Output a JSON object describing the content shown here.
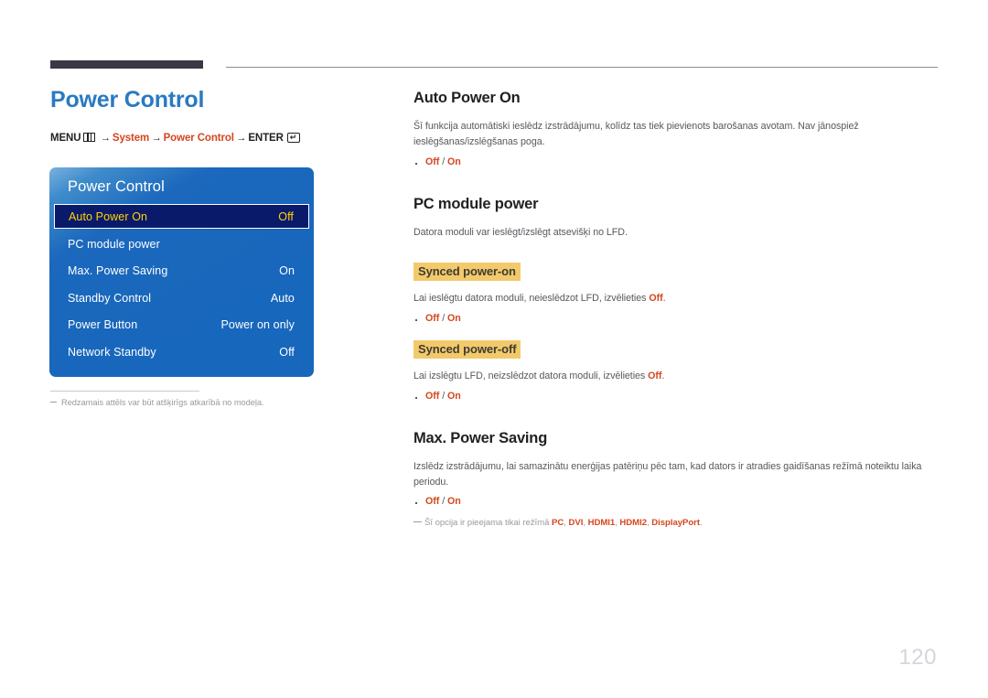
{
  "page": {
    "number": "120"
  },
  "left": {
    "title": "Power Control",
    "breadcrumb": {
      "menu_label": "MENU",
      "menu_icon": "menu-grid-icon",
      "arrow": "→",
      "step1": "System",
      "step2": "Power Control",
      "enter_label": "ENTER",
      "enter_icon": "enter-return-icon"
    },
    "osd": {
      "title": "Power Control",
      "rows": [
        {
          "label": "Auto Power On",
          "value": "Off",
          "selected": true
        },
        {
          "label": "PC module power",
          "value": "",
          "selected": false
        },
        {
          "label": "Max. Power Saving",
          "value": "On",
          "selected": false
        },
        {
          "label": "Standby Control",
          "value": "Auto",
          "selected": false
        },
        {
          "label": "Power Button",
          "value": "Power on only",
          "selected": false
        },
        {
          "label": "Network Standby",
          "value": "Off",
          "selected": false
        }
      ]
    },
    "note": "Redzamais attēls var būt atšķirīgs atkarībā no modeļa."
  },
  "right": {
    "sections": [
      {
        "heading": "Auto Power On",
        "paragraph": "Šī funkcija automātiski ieslēdz izstrādājumu, kolīdz tas tiek pievienots barošanas avotam. Nav jānospiež ieslēgšanas/izslēgšanas poga.",
        "bullet_off": "Off",
        "bullet_sep": " / ",
        "bullet_on": "On"
      },
      {
        "heading": "PC module power",
        "paragraph": "Datora moduli var ieslēgt/izslēgt atsevišķi no LFD.",
        "sub1": {
          "heading": "Synced power-on",
          "text_before": "Lai ieslēgtu datora moduli, neieslēdzot LFD, izvēlieties ",
          "text_accent": "Off",
          "text_after": ".",
          "bullet_off": "Off",
          "bullet_sep": " / ",
          "bullet_on": "On"
        },
        "sub2": {
          "heading": "Synced power-off",
          "text_before": "Lai izslēgtu LFD, neizslēdzot datora moduli, izvēlieties ",
          "text_accent": "Off",
          "text_after": ".",
          "bullet_off": "Off",
          "bullet_sep": " / ",
          "bullet_on": "On"
        }
      },
      {
        "heading": "Max. Power Saving",
        "paragraph": "Izslēdz izstrādājumu, lai samazinātu enerģijas patēriņu pēc tam, kad dators ir atradies gaidīšanas režīmā noteiktu laika periodu.",
        "bullet_off": "Off",
        "bullet_sep": " / ",
        "bullet_on": "On",
        "note": {
          "text_before": "Šī opcija ir pieejama tikai režīmā ",
          "mode1": "PC",
          "sep1": ", ",
          "mode2": "DVI",
          "sep2": ", ",
          "mode3": "HDMI1",
          "sep3": ", ",
          "mode4": "HDMI2",
          "sep4": ", ",
          "mode5": "DisplayPort",
          "text_after": "."
        }
      }
    ]
  },
  "colors": {
    "title_blue": "#2a7ac2",
    "accent_orange": "#d4461f",
    "highlight_yellow": "#f2ca6b",
    "osd_blue": "#1767bc",
    "osd_selected_navy": "#0a1a6b",
    "osd_selected_text": "#ffd400",
    "body_gray": "#58585f",
    "note_gray": "#9a9aa2",
    "rule_dark": "#3b3744"
  }
}
